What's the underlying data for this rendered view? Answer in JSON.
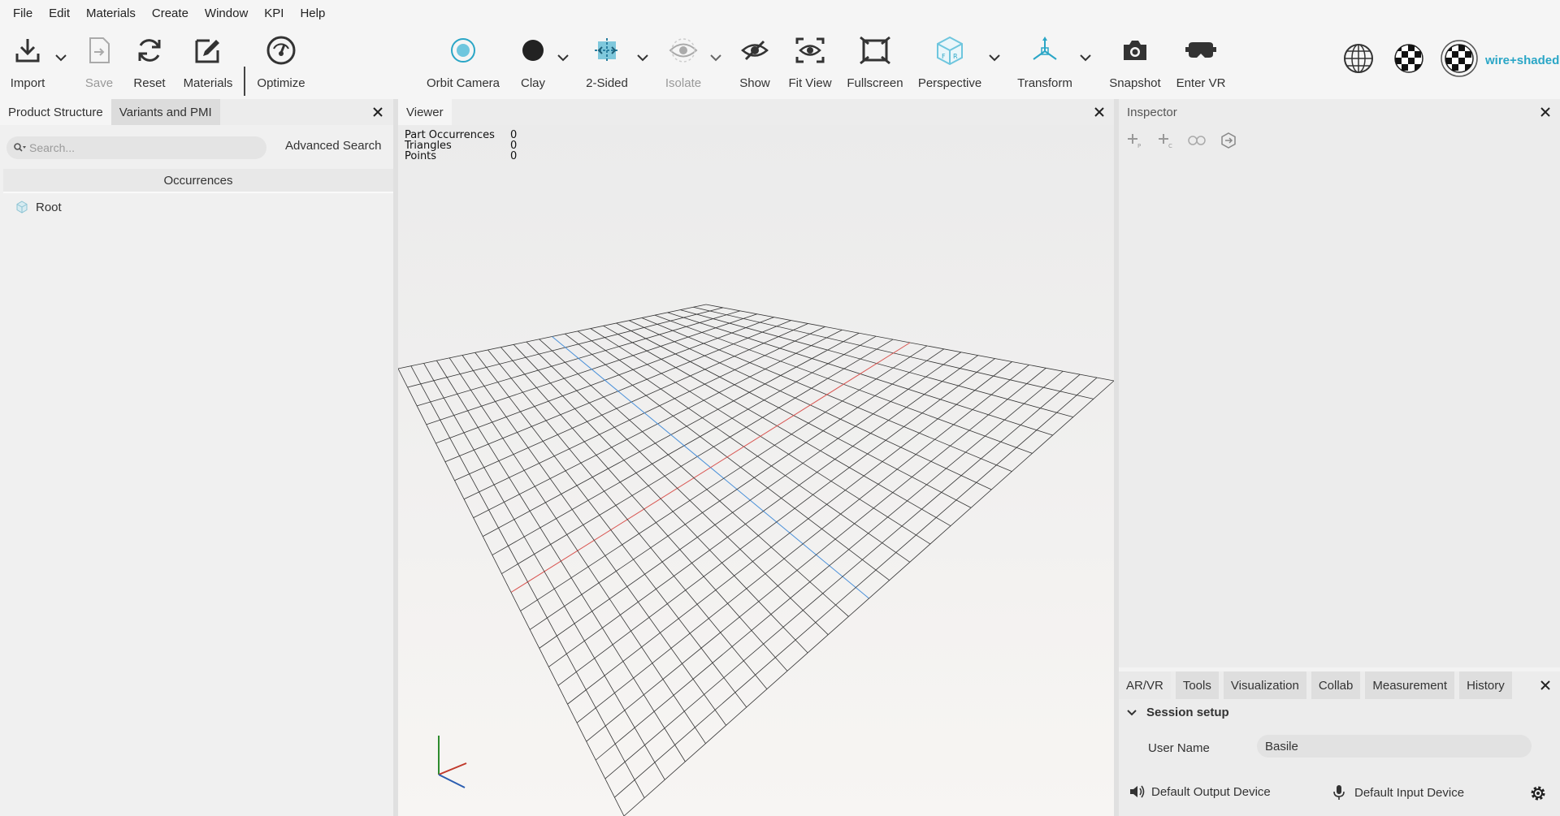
{
  "menu": [
    "File",
    "Edit",
    "Materials",
    "Create",
    "Window",
    "KPI",
    "Help"
  ],
  "toolbar": {
    "import": "Import",
    "save": "Save",
    "reset": "Reset",
    "materials": "Materials",
    "optimize": "Optimize",
    "orbit_camera": "Orbit Camera",
    "clay": "Clay",
    "two_sided": "2-Sided",
    "isolate": "Isolate",
    "show": "Show",
    "fit_view": "Fit View",
    "fullscreen": "Fullscreen",
    "perspective": "Perspective",
    "transform": "Transform",
    "snapshot": "Snapshot",
    "enter_vr": "Enter VR",
    "render_mode": "wire+shaded"
  },
  "left_panel": {
    "tabs": [
      "Product Structure",
      "Variants and PMI"
    ],
    "search_placeholder": "Search...",
    "advanced_search": "Advanced Search",
    "column_header": "Occurrences",
    "tree": [
      "Root"
    ]
  },
  "viewer": {
    "tab": "Viewer",
    "stats": [
      {
        "label": "Part Occurrences",
        "value": "0"
      },
      {
        "label": "Triangles",
        "value": "0"
      },
      {
        "label": "Points",
        "value": "0"
      }
    ]
  },
  "inspector": {
    "tab": "Inspector"
  },
  "bottom_panel": {
    "tabs": [
      "AR/VR",
      "Tools",
      "Visualization",
      "Collab",
      "Measurement",
      "History"
    ],
    "section_title": "Session setup",
    "user_name_label": "User Name",
    "user_name_value": "Basile",
    "output_device": "Default Output Device",
    "input_device": "Default Input Device"
  },
  "colors": {
    "accent": "#2aa6c6",
    "axis_x": "#d9534f",
    "axis_z": "#4a90d9"
  }
}
